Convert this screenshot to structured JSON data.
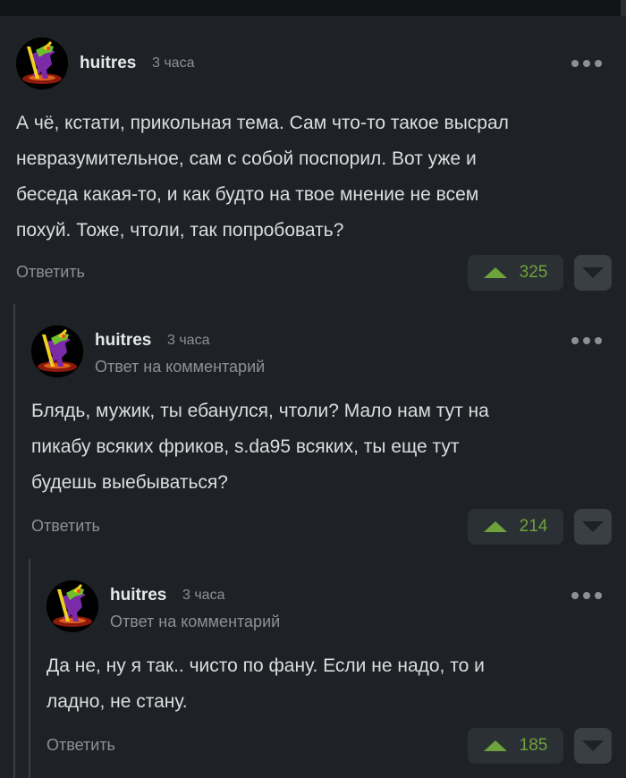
{
  "comments": [
    {
      "author": "huitres",
      "time": "3 часа",
      "reply_to": "",
      "lines": [
        "А чё, кстати, прикольная тема. Сам что-то такое высрал",
        "невразумительное, сам с собой поспорил. Вот уже и",
        "беседа какая-то, и как будто на твое мнение не всем",
        "похуй. Тоже, чтоли, так попробовать?"
      ],
      "reply_label": "Ответить",
      "rating": "325"
    },
    {
      "author": "huitres",
      "time": "3 часа",
      "reply_to": "Ответ на комментарий",
      "lines": [
        "Блядь, мужик, ты ебанулся, чтоли? Мало нам тут на",
        "пикабу всяких фриков, s.da95 всяких, ты еще тут",
        "будешь выебываться?"
      ],
      "reply_label": "Ответить",
      "rating": "214"
    },
    {
      "author": "huitres",
      "time": "3 часа",
      "reply_to": "Ответ на комментарий",
      "lines": [
        "Да не, ну я так.. чисто по фану. Если не надо, то и",
        "ладно, не стану."
      ],
      "reply_label": "Ответить",
      "rating": "185"
    }
  ],
  "colors": {
    "background": "#1e2125",
    "upvote": "#6ea23a",
    "muted_text": "#8d9196"
  },
  "icons": {
    "avatar": "hunched-goblin-avatar-icon",
    "more": "more-dots-icon",
    "upvote": "upvote-arrow-icon",
    "downvote": "downvote-arrow-icon"
  }
}
